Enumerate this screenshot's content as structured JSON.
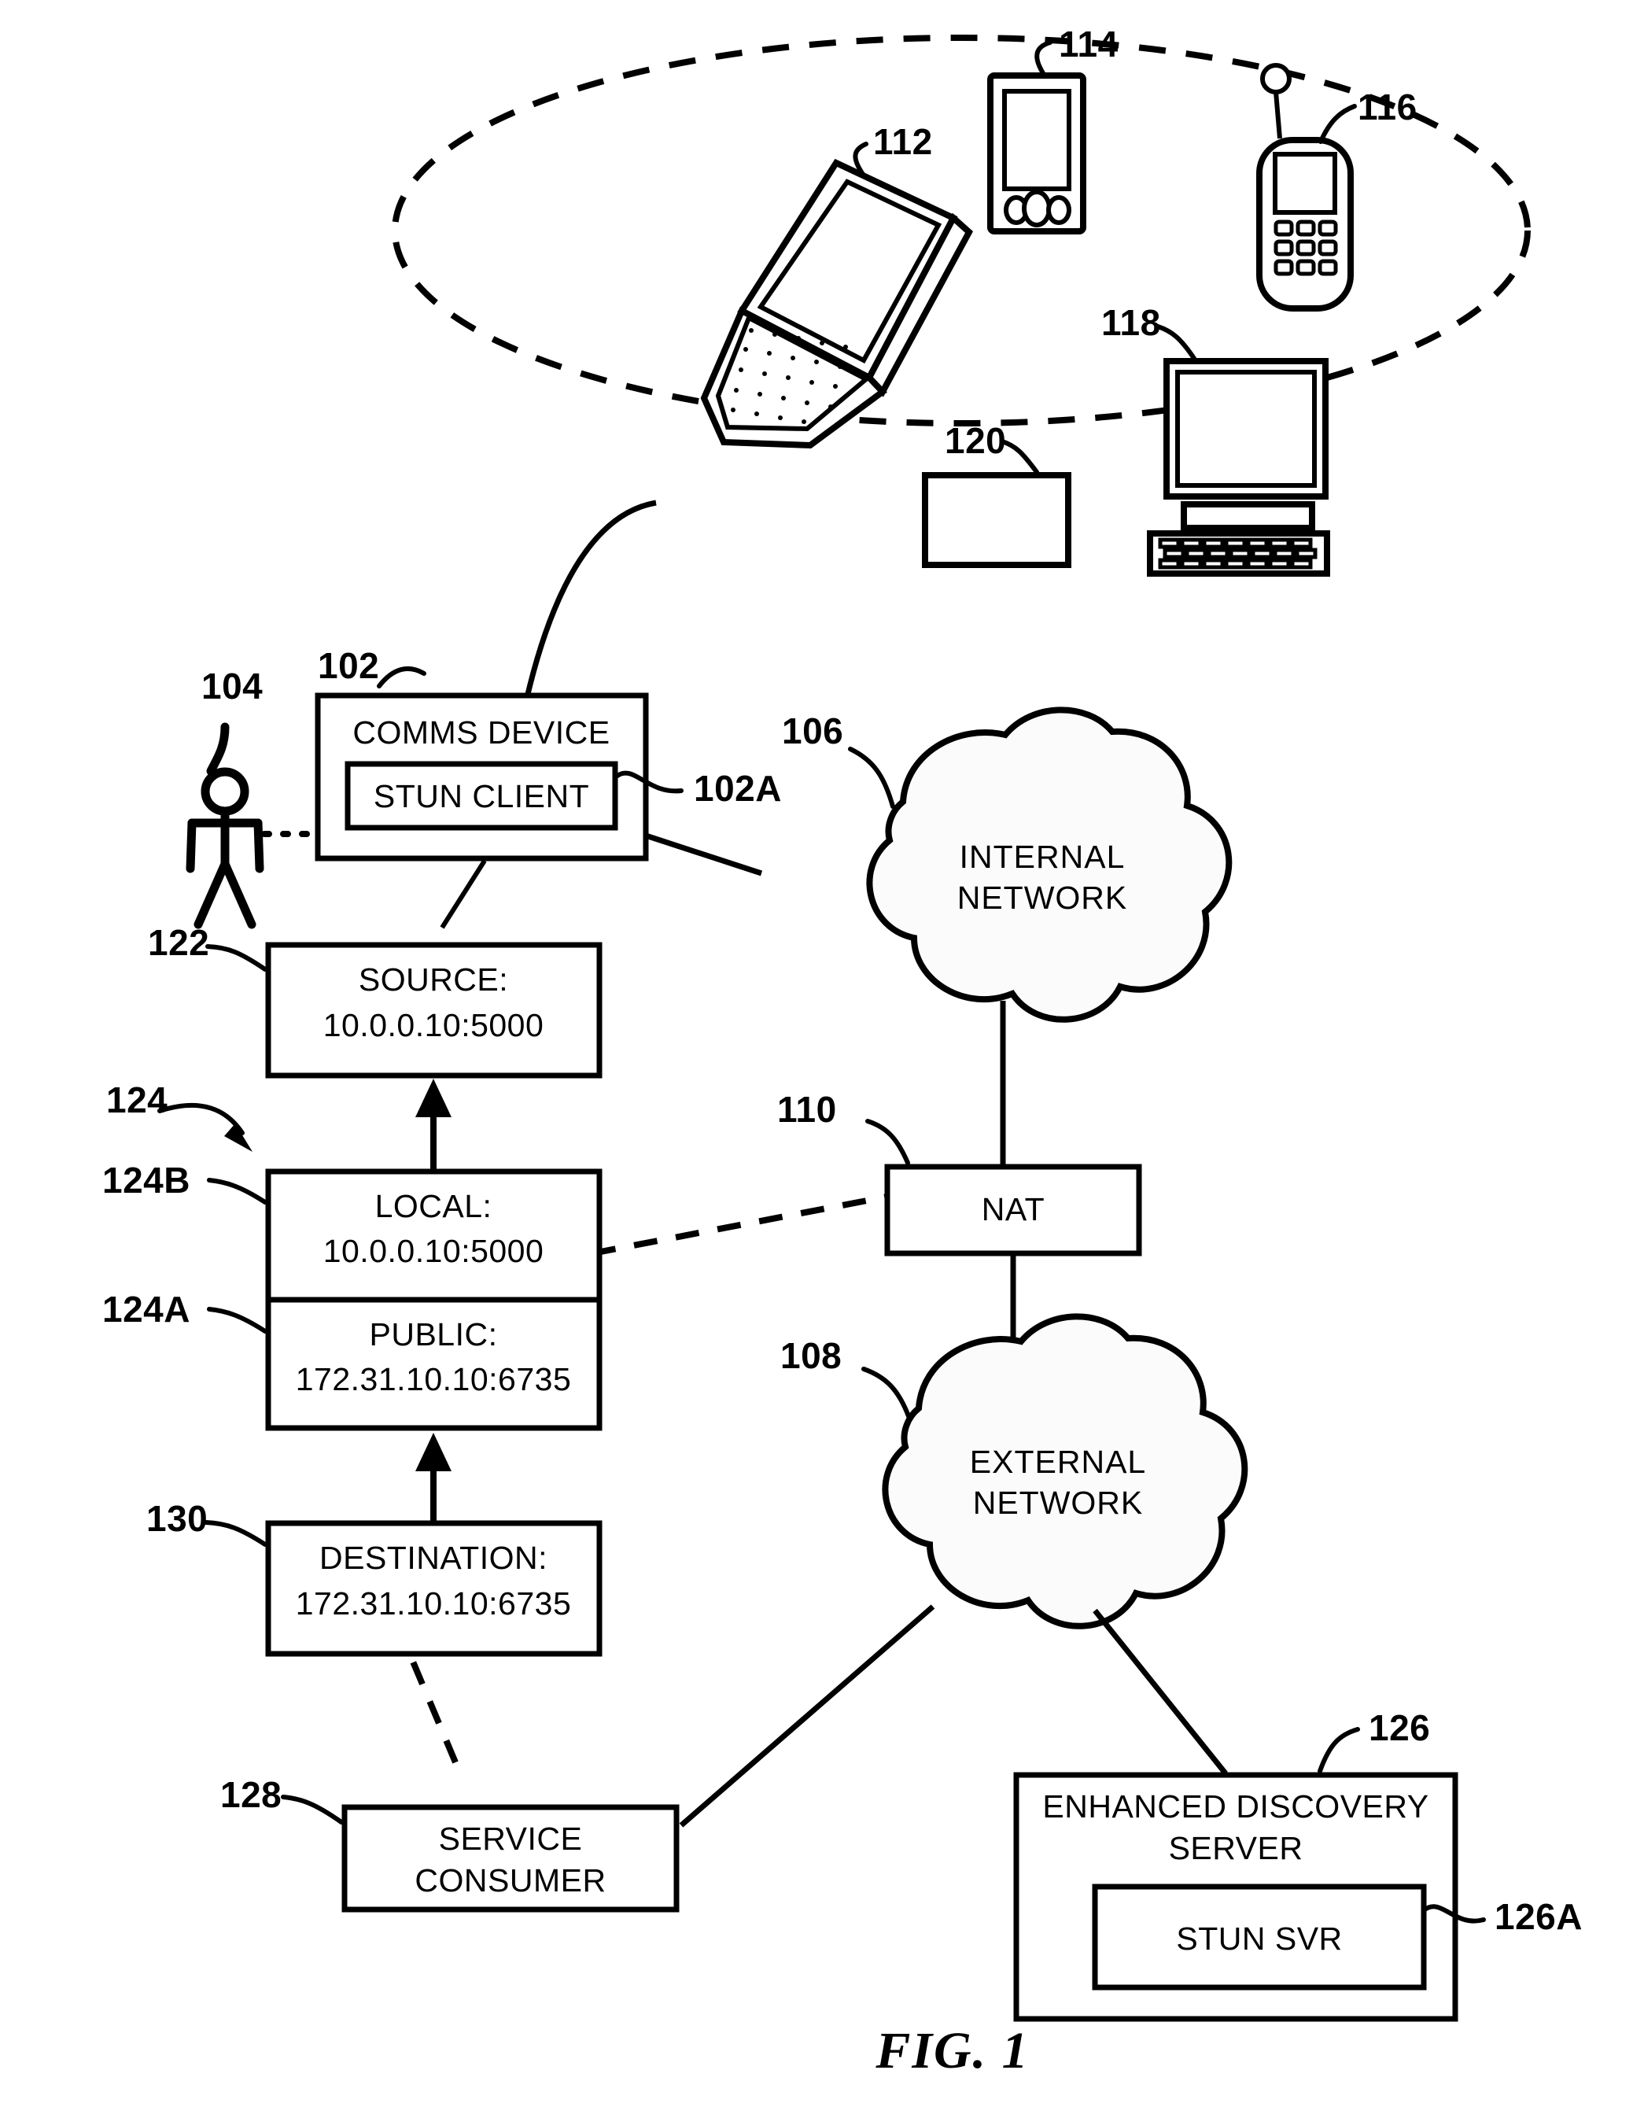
{
  "figure": {
    "caption": "FIG. 1"
  },
  "ellipse": {
    "name": "device-group-ellipse"
  },
  "devices": [
    {
      "ref": "112",
      "kind": "laptop-icon"
    },
    {
      "ref": "114",
      "kind": "pda-icon"
    },
    {
      "ref": "116",
      "kind": "mobile-phone-icon"
    },
    {
      "ref": "118",
      "kind": "desktop-computer-icon"
    },
    {
      "ref": "120",
      "kind": "blank-device-box"
    }
  ],
  "nodes": {
    "comms_device": {
      "ref": "102",
      "label": "COMMS DEVICE",
      "inner": {
        "ref": "102A",
        "label": "STUN CLIENT"
      }
    },
    "user": {
      "ref": "104",
      "label": ""
    },
    "internal_network": {
      "ref": "106",
      "line1": "INTERNAL",
      "line2": "NETWORK"
    },
    "external_network": {
      "ref": "108",
      "line1": "EXTERNAL",
      "line2": "NETWORK"
    },
    "nat": {
      "ref": "110",
      "label": "NAT"
    },
    "source": {
      "ref": "122",
      "line1": "SOURCE:",
      "line2": "10.0.0.10:5000"
    },
    "address_pair": {
      "ref": "124",
      "local": {
        "ref": "124B",
        "line1": "LOCAL:",
        "line2": "10.0.0.10:5000"
      },
      "public": {
        "ref": "124A",
        "line1": "PUBLIC:",
        "line2": "172.31.10.10:6735"
      }
    },
    "destination": {
      "ref": "130",
      "line1": "DESTINATION:",
      "line2": "172.31.10.10:6735"
    },
    "service_consumer": {
      "ref": "128",
      "line1": "SERVICE",
      "line2": "CONSUMER"
    },
    "discovery_server": {
      "ref": "126",
      "line1": "ENHANCED DISCOVERY",
      "line2": "SERVER",
      "inner": {
        "ref": "126A",
        "label": "STUN SVR"
      }
    }
  },
  "colors": {
    "ink": "#000000",
    "paper": "#ffffff",
    "cloud_fill": "#fbfbfb"
  }
}
